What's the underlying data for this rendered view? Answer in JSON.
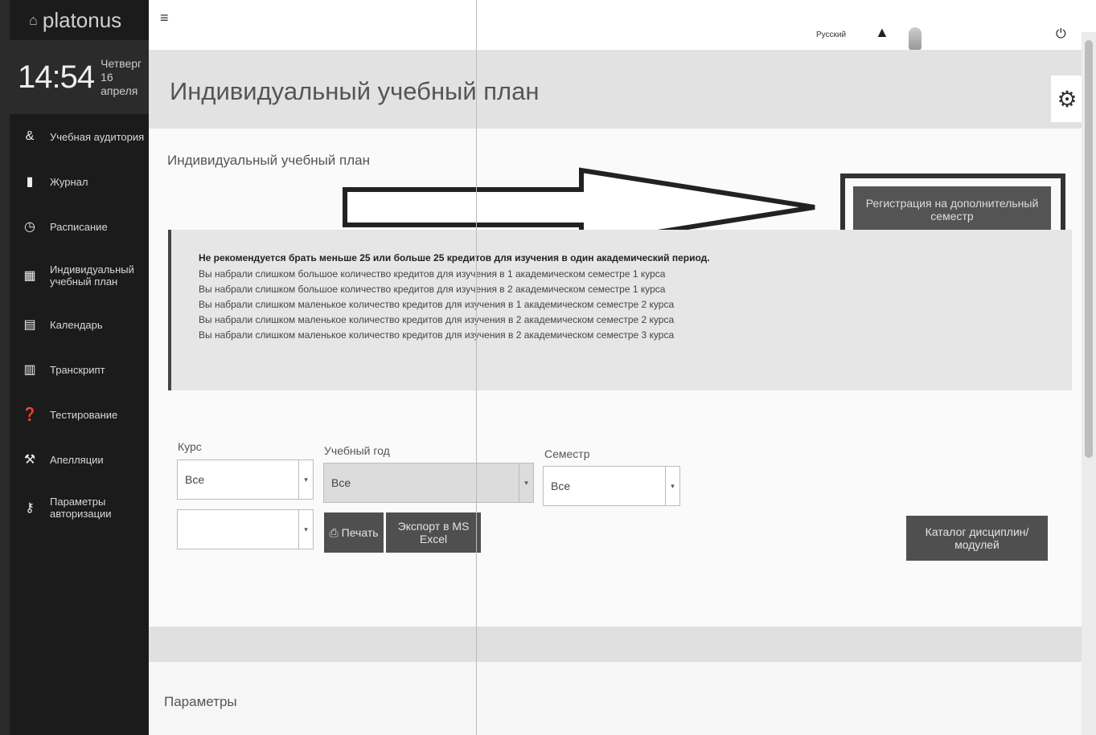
{
  "sidebar": {
    "logo": "platonus",
    "clock": {
      "time": "14:54",
      "weekday": "Четверг",
      "date": "16 апреля"
    },
    "items": [
      {
        "label": "Учебная аудитория",
        "icon": "users-icon"
      },
      {
        "label": "Журнал",
        "icon": "book-icon"
      },
      {
        "label": "Расписание",
        "icon": "clock-icon"
      },
      {
        "label": "Индивидуальный учебный план",
        "icon": "grid-icon"
      },
      {
        "label": "Календарь",
        "icon": "calendar-icon"
      },
      {
        "label": "Транскрипт",
        "icon": "table-icon"
      },
      {
        "label": "Тестирование",
        "icon": "question-icon"
      },
      {
        "label": "Апелляции",
        "icon": "gavel-icon"
      },
      {
        "label": "Параметры авторизации",
        "icon": "key-icon"
      }
    ]
  },
  "topbar": {
    "language": "Русский"
  },
  "page": {
    "title": "Индивидуальный учебный план",
    "panel_title": "Индивидуальный учебный план",
    "register_button": "Регистрация на дополнительный семестр"
  },
  "alert": {
    "heading": "Не рекомендуется брать меньше 25 или больше 25 кредитов для изучения в один академический период.",
    "lines": [
      "Вы набрали слишком большое количество кредитов для изучения в 1 академическом семестре 1 курса",
      "Вы набрали слишком большое количество кредитов для изучения в 2 академическом семестре 1 курса",
      "Вы набрали слишком маленькое количество кредитов для изучения в 1 академическом семестре 2 курса",
      "Вы набрали слишком маленькое количество кредитов для изучения в 2 академическом семестре 2 курса",
      "Вы набрали слишком маленькое количество кредитов для изучения в 2 академическом семестре 3 курса"
    ]
  },
  "filters": {
    "course": {
      "label": "Курс",
      "value": "Все"
    },
    "year": {
      "label": "Учебный год",
      "value": "Все"
    },
    "semester": {
      "label": "Семестр",
      "value": "Все"
    },
    "extra": {
      "value": ""
    }
  },
  "buttons": {
    "print": "Печать",
    "export": "Экспорт в MS Excel",
    "catalog": "Каталог дисциплин/модулей"
  },
  "sections": {
    "params": "Параметры"
  }
}
